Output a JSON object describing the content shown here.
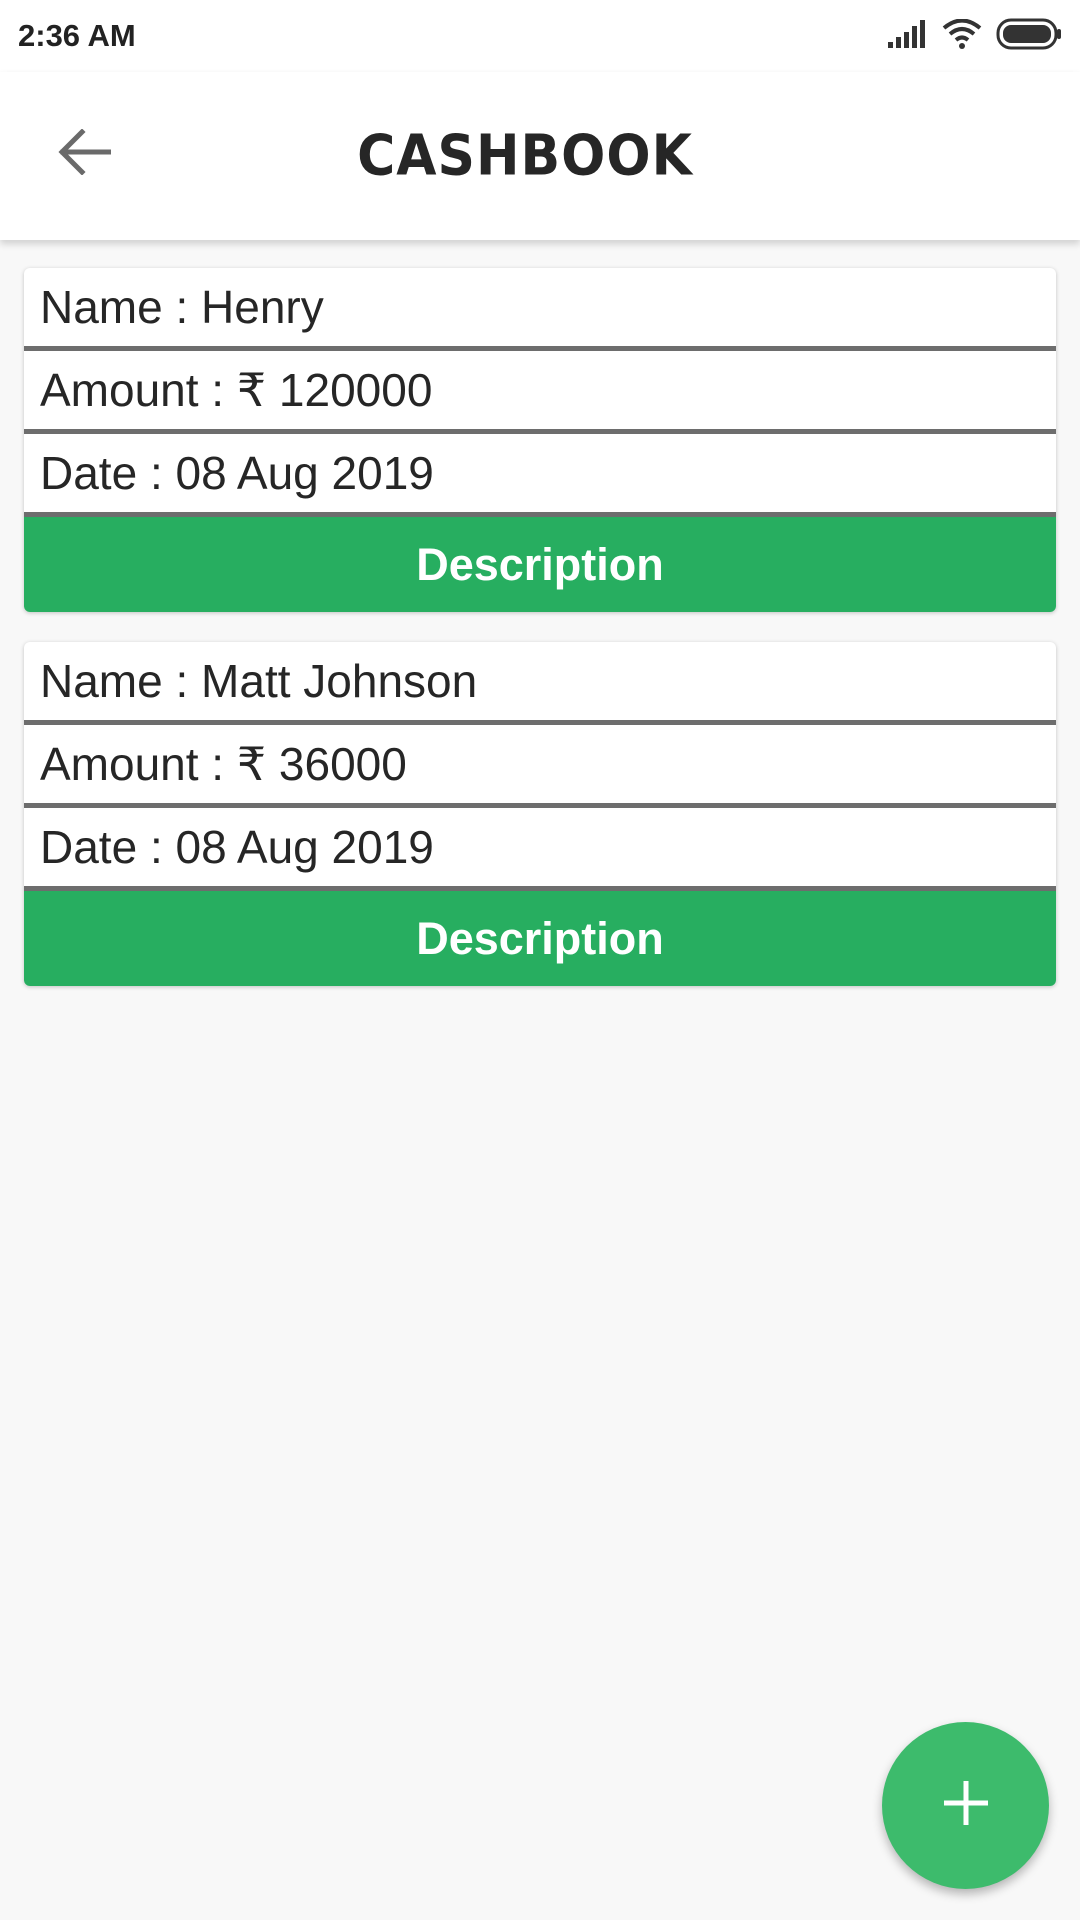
{
  "status_bar": {
    "time": "2:36 AM",
    "icons": [
      "signal-icon",
      "wifi-icon",
      "battery-icon"
    ]
  },
  "app_bar": {
    "title": "CASHBOOK",
    "back_icon": "arrow-left-icon"
  },
  "entries": [
    {
      "name_row": "Name : Henry",
      "amount_row": "Amount : ₹ 120000",
      "date_row": "Date : 08 Aug 2019",
      "button_label": "Description"
    },
    {
      "name_row": "Name : Matt Johnson",
      "amount_row": "Amount : ₹ 36000",
      "date_row": "Date : 08 Aug 2019",
      "button_label": "Description"
    }
  ],
  "fab": {
    "icon": "plus-icon"
  },
  "colors": {
    "accent_green": "#27ae60",
    "fab_green": "#3dbb6c",
    "divider": "#6d6d6d",
    "background": "#f8f8f8"
  }
}
